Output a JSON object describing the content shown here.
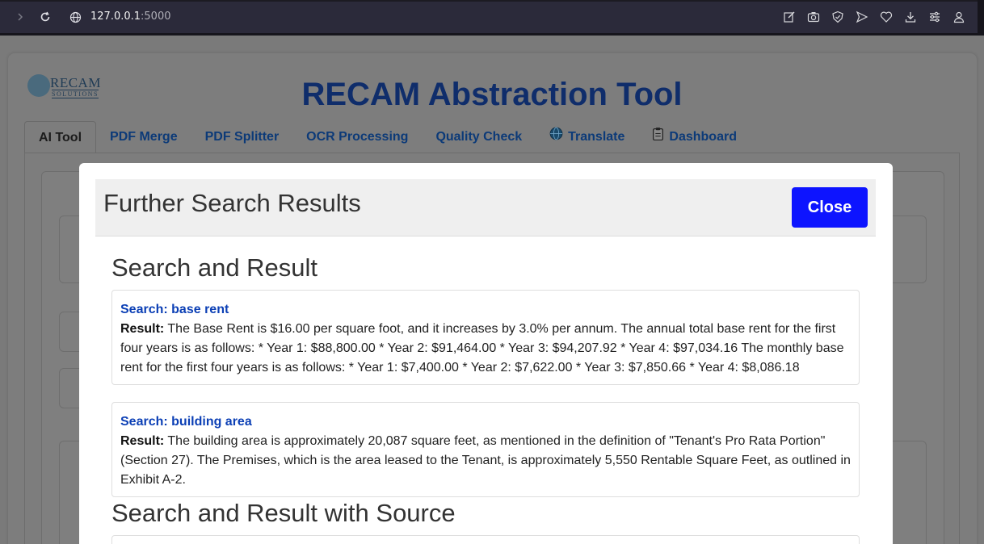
{
  "browser": {
    "url_host": "127.0.0.1",
    "url_port": ":5000"
  },
  "app": {
    "logo_text": "RECAM",
    "logo_sub": "SOLUTIONS",
    "title": "RECAM Abstraction Tool"
  },
  "tabs": [
    {
      "label": "AI Tool",
      "active": true
    },
    {
      "label": "PDF Merge"
    },
    {
      "label": "PDF Splitter"
    },
    {
      "label": "OCR Processing"
    },
    {
      "label": "Quality Check"
    },
    {
      "label": "Translate",
      "icon": "globe-icon"
    },
    {
      "label": "Dashboard",
      "icon": "clipboard-icon"
    }
  ],
  "modal": {
    "title": "Further Search Results",
    "close_label": "Close",
    "section1_title": "Search and Result",
    "results": [
      {
        "search_label": "Search:",
        "query": "base rent",
        "result_label": "Result:",
        "text": "The Base Rent is $16.00 per square foot, and it increases by 3.0% per annum. The annual total base rent for the first four years is as follows: * Year 1: $88,800.00 * Year 2: $91,464.00 * Year 3: $94,207.92 * Year 4: $97,034.16 The monthly base rent for the first four years is as follows: * Year 1: $7,400.00 * Year 2: $7,622.00 * Year 3: $7,850.66 * Year 4: $8,086.18"
      },
      {
        "search_label": "Search:",
        "query": "building area",
        "result_label": "Result:",
        "text": "The building area is approximately 20,087 square feet, as mentioned in the definition of \"Tenant's Pro Rata Portion\" (Section 27). The Premises, which is the area leased to the Tenant, is approximately 5,550 Rentable Square Feet, as outlined in Exhibit A-2."
      }
    ],
    "section2_title": "Search and Result with Source"
  }
}
